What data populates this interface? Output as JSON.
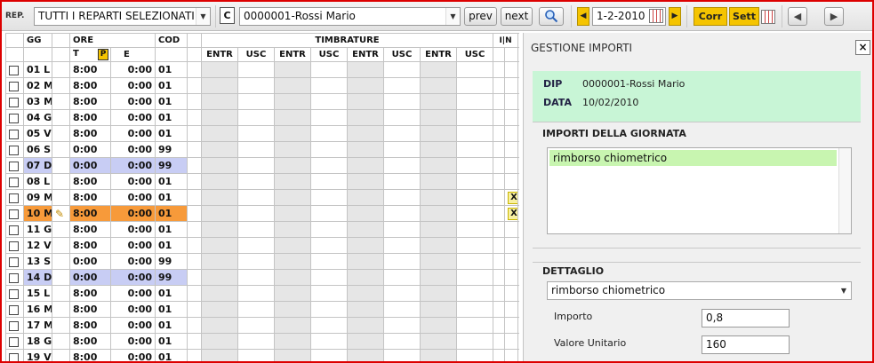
{
  "toolbar": {
    "rep_label": "REP.",
    "reparti_value": "TUTTI I REPARTI SELEZIONATI",
    "c_box": "C",
    "employee_value": "0000001-Rossi Mario",
    "prev_label": "prev",
    "next_label": "next",
    "date_value": "1-2-2010",
    "corr_label": "Corr",
    "sett_label": "Sett",
    "back_icon": "arrow-left-icon",
    "forward_icon": "arrow-right-icon",
    "search_icon": "magnifier-icon"
  },
  "grid": {
    "headers": {
      "gg": "GG",
      "ore": "ORE",
      "cod": "COD",
      "timbrature": "TIMBRATURE",
      "in": "I|N",
      "t": "T",
      "p": "P",
      "e": "E",
      "stamps": [
        "ENTR",
        "USC",
        "ENTR",
        "USC",
        "ENTR",
        "USC",
        "ENTR",
        "USC"
      ]
    },
    "rows": [
      {
        "gg": "01 L",
        "t": "8:00",
        "e": "0:00",
        "cod": "01",
        "type": "normal",
        "x": ""
      },
      {
        "gg": "02 M",
        "t": "8:00",
        "e": "0:00",
        "cod": "01",
        "type": "normal",
        "x": ""
      },
      {
        "gg": "03 M",
        "t": "8:00",
        "e": "0:00",
        "cod": "01",
        "type": "normal",
        "x": ""
      },
      {
        "gg": "04 G",
        "t": "8:00",
        "e": "0:00",
        "cod": "01",
        "type": "normal",
        "x": ""
      },
      {
        "gg": "05 V",
        "t": "8:00",
        "e": "0:00",
        "cod": "01",
        "type": "normal",
        "x": ""
      },
      {
        "gg": "06 S",
        "t": "0:00",
        "e": "0:00",
        "cod": "99",
        "type": "normal",
        "x": ""
      },
      {
        "gg": "07 D",
        "t": "0:00",
        "e": "0:00",
        "cod": "99",
        "type": "sun",
        "x": ""
      },
      {
        "gg": "08 L",
        "t": "8:00",
        "e": "0:00",
        "cod": "01",
        "type": "normal",
        "x": ""
      },
      {
        "gg": "09 M",
        "t": "8:00",
        "e": "0:00",
        "cod": "01",
        "type": "normal",
        "x": "X"
      },
      {
        "gg": "10 M",
        "t": "8:00",
        "e": "0:00",
        "cod": "01",
        "type": "sel",
        "x": "X"
      },
      {
        "gg": "11 G",
        "t": "8:00",
        "e": "0:00",
        "cod": "01",
        "type": "normal",
        "x": ""
      },
      {
        "gg": "12 V",
        "t": "8:00",
        "e": "0:00",
        "cod": "01",
        "type": "normal",
        "x": ""
      },
      {
        "gg": "13 S",
        "t": "0:00",
        "e": "0:00",
        "cod": "99",
        "type": "normal",
        "x": ""
      },
      {
        "gg": "14 D",
        "t": "0:00",
        "e": "0:00",
        "cod": "99",
        "type": "sun",
        "x": ""
      },
      {
        "gg": "15 L",
        "t": "8:00",
        "e": "0:00",
        "cod": "01",
        "type": "normal",
        "x": ""
      },
      {
        "gg": "16 M",
        "t": "8:00",
        "e": "0:00",
        "cod": "01",
        "type": "normal",
        "x": ""
      },
      {
        "gg": "17 M",
        "t": "8:00",
        "e": "0:00",
        "cod": "01",
        "type": "normal",
        "x": ""
      },
      {
        "gg": "18 G",
        "t": "8:00",
        "e": "0:00",
        "cod": "01",
        "type": "normal",
        "x": ""
      },
      {
        "gg": "19 V",
        "t": "8:00",
        "e": "0:00",
        "cod": "01",
        "type": "normal",
        "x": ""
      }
    ]
  },
  "panel": {
    "title": "GESTIONE IMPORTI",
    "close_label": "×",
    "dip_label": "DIP",
    "dip_value": "0000001-Rossi Mario",
    "data_label": "DATA",
    "data_value": "10/02/2010",
    "importi_title": "IMPORTI DELLA GIORNATA",
    "importi_items": [
      "rimborso chiometrico"
    ],
    "dettaglio_title": "DETTAGLIO",
    "dettaglio_select": "rimborso chiometrico",
    "importo_label": "Importo",
    "importo_value": "0,8",
    "valore_label": "Valore Unitario",
    "valore_value": "160"
  }
}
